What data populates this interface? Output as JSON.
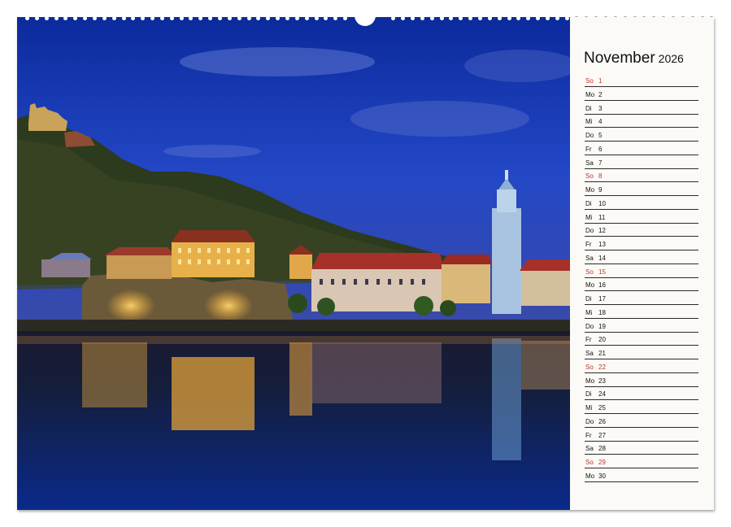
{
  "calendar": {
    "month": "November",
    "year": "2026",
    "days": [
      {
        "name": "So",
        "date": "1",
        "sunday": true
      },
      {
        "name": "Mo",
        "date": "2",
        "sunday": false
      },
      {
        "name": "Di",
        "date": "3",
        "sunday": false
      },
      {
        "name": "Mi",
        "date": "4",
        "sunday": false
      },
      {
        "name": "Do",
        "date": "5",
        "sunday": false
      },
      {
        "name": "Fr",
        "date": "6",
        "sunday": false
      },
      {
        "name": "Sa",
        "date": "7",
        "sunday": false
      },
      {
        "name": "So",
        "date": "8",
        "sunday": true
      },
      {
        "name": "Mo",
        "date": "9",
        "sunday": false
      },
      {
        "name": "Di",
        "date": "10",
        "sunday": false
      },
      {
        "name": "Mi",
        "date": "11",
        "sunday": false
      },
      {
        "name": "Do",
        "date": "12",
        "sunday": false
      },
      {
        "name": "Fr",
        "date": "13",
        "sunday": false
      },
      {
        "name": "Sa",
        "date": "14",
        "sunday": false
      },
      {
        "name": "So",
        "date": "15",
        "sunday": true
      },
      {
        "name": "Mo",
        "date": "16",
        "sunday": false
      },
      {
        "name": "Di",
        "date": "17",
        "sunday": false
      },
      {
        "name": "Mi",
        "date": "18",
        "sunday": false
      },
      {
        "name": "Do",
        "date": "19",
        "sunday": false
      },
      {
        "name": "Fr",
        "date": "20",
        "sunday": false
      },
      {
        "name": "Sa",
        "date": "21",
        "sunday": false
      },
      {
        "name": "So",
        "date": "22",
        "sunday": true
      },
      {
        "name": "Mo",
        "date": "23",
        "sunday": false
      },
      {
        "name": "Di",
        "date": "24",
        "sunday": false
      },
      {
        "name": "Mi",
        "date": "25",
        "sunday": false
      },
      {
        "name": "Do",
        "date": "26",
        "sunday": false
      },
      {
        "name": "Fr",
        "date": "27",
        "sunday": false
      },
      {
        "name": "Sa",
        "date": "28",
        "sunday": false
      },
      {
        "name": "So",
        "date": "29",
        "sunday": true
      },
      {
        "name": "Mo",
        "date": "30",
        "sunday": false
      }
    ]
  },
  "colors": {
    "sunday": "#c4322e",
    "rule": "#2a2a2a"
  }
}
